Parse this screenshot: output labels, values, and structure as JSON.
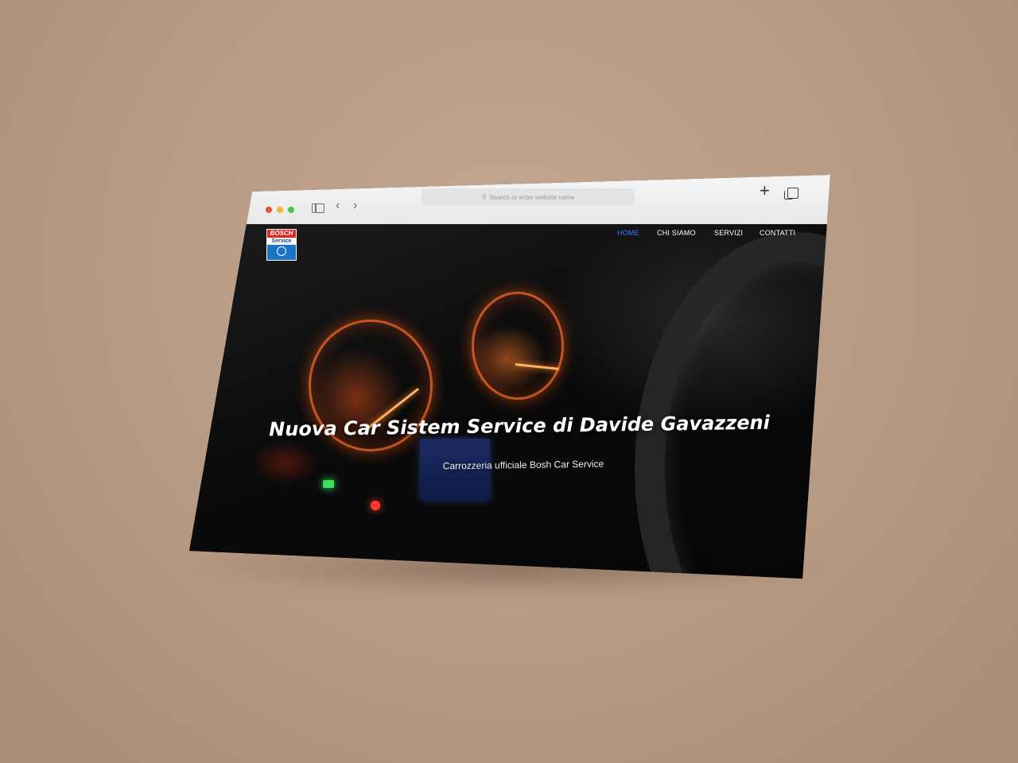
{
  "browser": {
    "address_placeholder": "Search or enter website name"
  },
  "site": {
    "logo": {
      "line1": "BOSCH",
      "line2": "Service"
    },
    "nav": [
      {
        "label": "HOME",
        "active": true
      },
      {
        "label": "CHI SIAMO",
        "active": false
      },
      {
        "label": "SERVIZI",
        "active": false
      },
      {
        "label": "CONTATTI",
        "active": false
      }
    ],
    "hero": {
      "title": "Nuova Car Sistem Service di Davide Gavazzeni",
      "subtitle": "Carrozzeria ufficiale Bosh Car Service"
    }
  },
  "colors": {
    "background": "#b89c86",
    "nav_active": "#2e7bff",
    "logo_red": "#e3241b",
    "logo_blue": "#1c73c8"
  }
}
